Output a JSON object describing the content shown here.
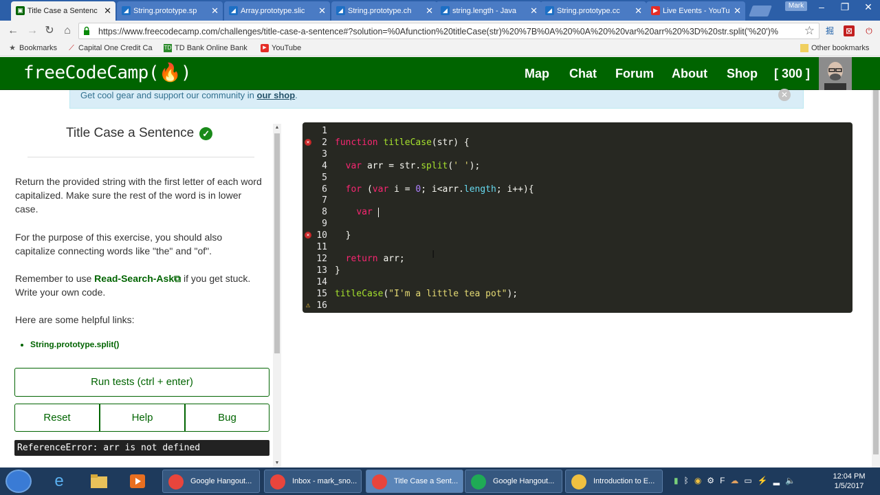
{
  "browser": {
    "tabs": [
      {
        "label": "Title Case a Sentenc",
        "icon": "fcc-icon",
        "active": true
      },
      {
        "label": "String.prototype.sp",
        "icon": "mdn-icon",
        "active": false
      },
      {
        "label": "Array.prototype.slic",
        "icon": "mdn-icon",
        "active": false
      },
      {
        "label": "String.prototype.ch",
        "icon": "mdn-icon",
        "active": false
      },
      {
        "label": "string.length - Java",
        "icon": "mdn-icon",
        "active": false
      },
      {
        "label": "String.prototype.cc",
        "icon": "mdn-icon",
        "active": false
      },
      {
        "label": "Live Events - YouTu",
        "icon": "youtube-icon",
        "active": false
      }
    ],
    "user": "Mark",
    "url": "https://www.freecodecamp.com/challenges/title-case-a-sentence#?solution=%0Afunction%20titleCase(str)%20%7B%0A%20%0A%20%20var%20arr%20%3D%20str.split('%20')%",
    "bookmarks": [
      {
        "label": "Bookmarks",
        "icon": "star-icon"
      },
      {
        "label": "Capital One Credit Ca",
        "icon": "capital-one-icon"
      },
      {
        "label": "TD Bank Online Bank",
        "icon": "td-icon"
      },
      {
        "label": "YouTube",
        "icon": "youtube-icon"
      },
      {
        "label": "Other bookmarks",
        "icon": "folder-icon"
      }
    ]
  },
  "site": {
    "logo": "freeCodeCamp(🔥)",
    "nav": [
      "Map",
      "Chat",
      "Forum",
      "About",
      "Shop",
      "[ 300 ]"
    ],
    "banner_text": "Get cool gear and support our community in ",
    "banner_link": "our shop",
    "banner_end": "."
  },
  "challenge": {
    "title": "Title Case a Sentence",
    "p1": "Return the provided string with the first letter of each word capitalized. Make sure the rest of the word is in lower case.",
    "p2": "For the purpose of this exercise, you should also capitalize connecting words like \"the\" and \"of\".",
    "p3_pre": "Remember to use ",
    "p3_link": "Read-Search-Ask",
    "p3_post": " if you get stuck. Write your own code.",
    "p4": "Here are some helpful links:",
    "links": [
      "String.prototype.split()"
    ],
    "run_label": "Run tests (ctrl + enter)",
    "reset_label": "Reset",
    "help_label": "Help",
    "bug_label": "Bug",
    "error": "ReferenceError: arr is not defined"
  },
  "editor": {
    "line_numbers": [
      "1",
      "2",
      "3",
      "4",
      "5",
      "6",
      "7",
      "8",
      "9",
      "10",
      "11",
      "12",
      "13",
      "14",
      "15",
      "16"
    ],
    "lines": [
      "",
      "function titleCase(str) {",
      "",
      "  var arr = str.split(' ');",
      "",
      "  for (var i = 0; i<arr.length; i++){",
      "",
      "    var ",
      "",
      "  }",
      "",
      "  return arr;",
      "}",
      "",
      "titleCase(\"I'm a little tea pot\");",
      ""
    ],
    "markers": {
      "2": "error",
      "10": "error",
      "16": "warning"
    }
  },
  "taskbar": {
    "tasks": [
      {
        "label": "Google Hangout...",
        "icon": "chrome-icon"
      },
      {
        "label": "Inbox - mark_sno...",
        "icon": "chrome-icon"
      },
      {
        "label": "Title Case a Sent...",
        "icon": "chrome-icon"
      },
      {
        "label": "Google Hangout...",
        "icon": "hangouts-icon"
      },
      {
        "label": "Introduction to E...",
        "icon": "help-icon"
      }
    ],
    "time": "12:04 PM",
    "date": "1/5/2017"
  }
}
